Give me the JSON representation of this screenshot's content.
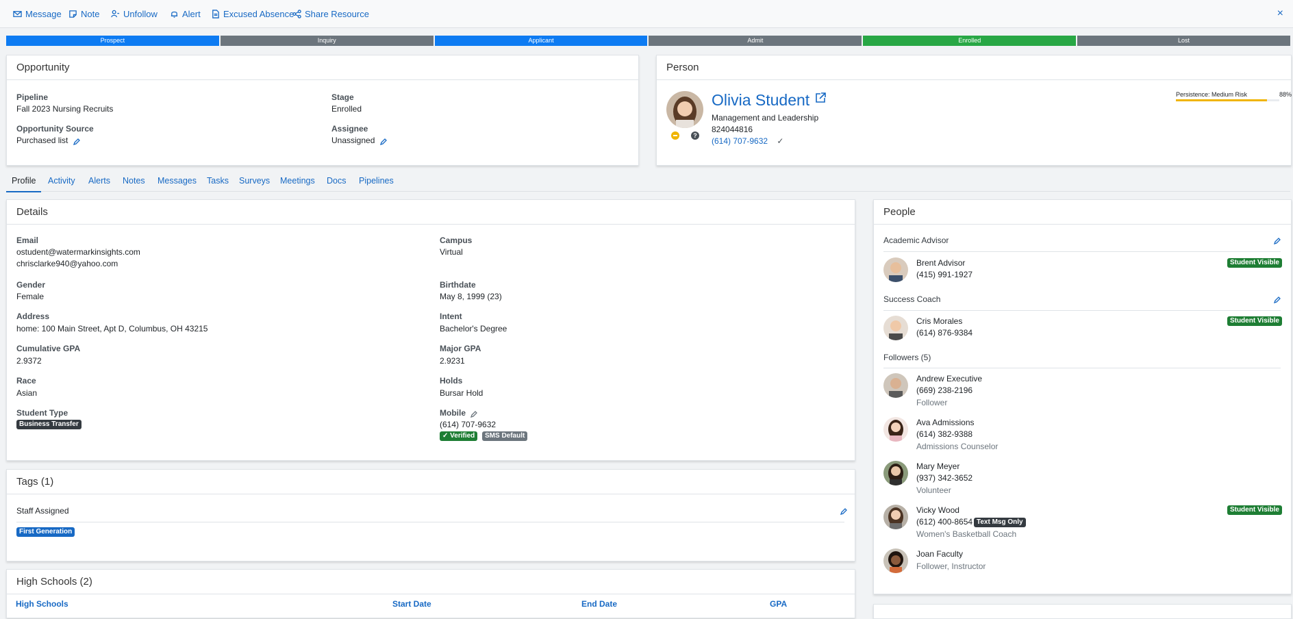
{
  "toolbar": {
    "items": [
      "Message",
      "Note",
      "Unfollow",
      "Alert",
      "Excused Absence",
      "Share Resource"
    ],
    "close": "×"
  },
  "stages": [
    {
      "label": "Prospect",
      "color": "#0d7bf2"
    },
    {
      "label": "Inquiry",
      "color": "#6c757d"
    },
    {
      "label": "Applicant",
      "color": "#0d7bf2"
    },
    {
      "label": "Admit",
      "color": "#6c757d"
    },
    {
      "label": "Enrolled",
      "color": "#28a745"
    },
    {
      "label": "Lost",
      "color": "#6c757d"
    }
  ],
  "opportunity": {
    "title": "Opportunity",
    "pipeline_label": "Pipeline",
    "pipeline_value": "Fall 2023 Nursing Recruits",
    "stage_label": "Stage",
    "stage_value": "Enrolled",
    "source_label": "Opportunity Source",
    "source_value": "Purchased list",
    "assignee_label": "Assignee",
    "assignee_value": "Unassigned"
  },
  "person": {
    "title": "Person",
    "name": "Olivia Student",
    "program": "Management and Leadership",
    "id": "824044816",
    "phone": "(614) 707-9632",
    "check": "✓",
    "persistence_label": "Persistence: Medium Risk",
    "persistence_pct": "88%",
    "persistence_value": 0.88,
    "persistence_color": "#f0b400",
    "icon_minus_color": "#f0b400"
  },
  "tabs": [
    "Profile",
    "Activity",
    "Alerts",
    "Notes",
    "Messages",
    "Tasks",
    "Surveys",
    "Meetings",
    "Docs",
    "Pipelines"
  ],
  "details": {
    "title": "Details",
    "email_label": "Email",
    "email_1": "ostudent@watermarkinsights.com",
    "email_2": "chrisclarke940@yahoo.com",
    "campus_label": "Campus",
    "campus_value": "Virtual",
    "gender_label": "Gender",
    "gender_value": "Female",
    "birthdate_label": "Birthdate",
    "birthdate_value": "May 8, 1999 (23)",
    "address_label": "Address",
    "address_value": "home: 100 Main Street, Apt D, Columbus, OH 43215",
    "intent_label": "Intent",
    "intent_value": "Bachelor's Degree",
    "cgpa_label": "Cumulative GPA",
    "cgpa_value": "2.9372",
    "mgpa_label": "Major GPA",
    "mgpa_value": "2.9231",
    "race_label": "Race",
    "race_value": "Asian",
    "holds_label": "Holds",
    "holds_value": "Bursar Hold",
    "stype_label": "Student Type",
    "stype_badge": "Business Transfer",
    "mobile_label": "Mobile",
    "mobile_value": "(614) 707-9632",
    "verified_badge": "✓ Verified",
    "sms_badge": "SMS Default"
  },
  "tags": {
    "title": "Tags (1)",
    "group_label": "Staff Assigned",
    "tag": "First Generation"
  },
  "highschools": {
    "title": "High Schools (2)",
    "columns": [
      "High Schools",
      "Start Date",
      "End Date",
      "GPA"
    ]
  },
  "people": {
    "title": "People",
    "advisor_label": "Academic Advisor",
    "coach_label": "Success Coach",
    "followers_label": "Followers (5)",
    "student_visible": "Student Visible",
    "text_only": "Text Msg Only",
    "list": [
      {
        "name": "Brent Advisor",
        "phone": "(415) 991-1927",
        "role": ""
      },
      {
        "name": "Cris Morales",
        "phone": "(614) 876-9384",
        "role": ""
      },
      {
        "name": "Andrew Executive",
        "phone": "(669) 238-2196",
        "role": "Follower"
      },
      {
        "name": "Ava Admissions",
        "phone": "(614) 382-9388",
        "role": "Admissions Counselor"
      },
      {
        "name": "Mary Meyer",
        "phone": "(937) 342-3652",
        "role": "Volunteer"
      },
      {
        "name": "Vicky Wood",
        "phone": "(612) 400-8654",
        "role": "Women's Basketball Coach"
      },
      {
        "name": "Joan Faculty",
        "phone": "",
        "role": "Follower, Instructor"
      }
    ]
  }
}
